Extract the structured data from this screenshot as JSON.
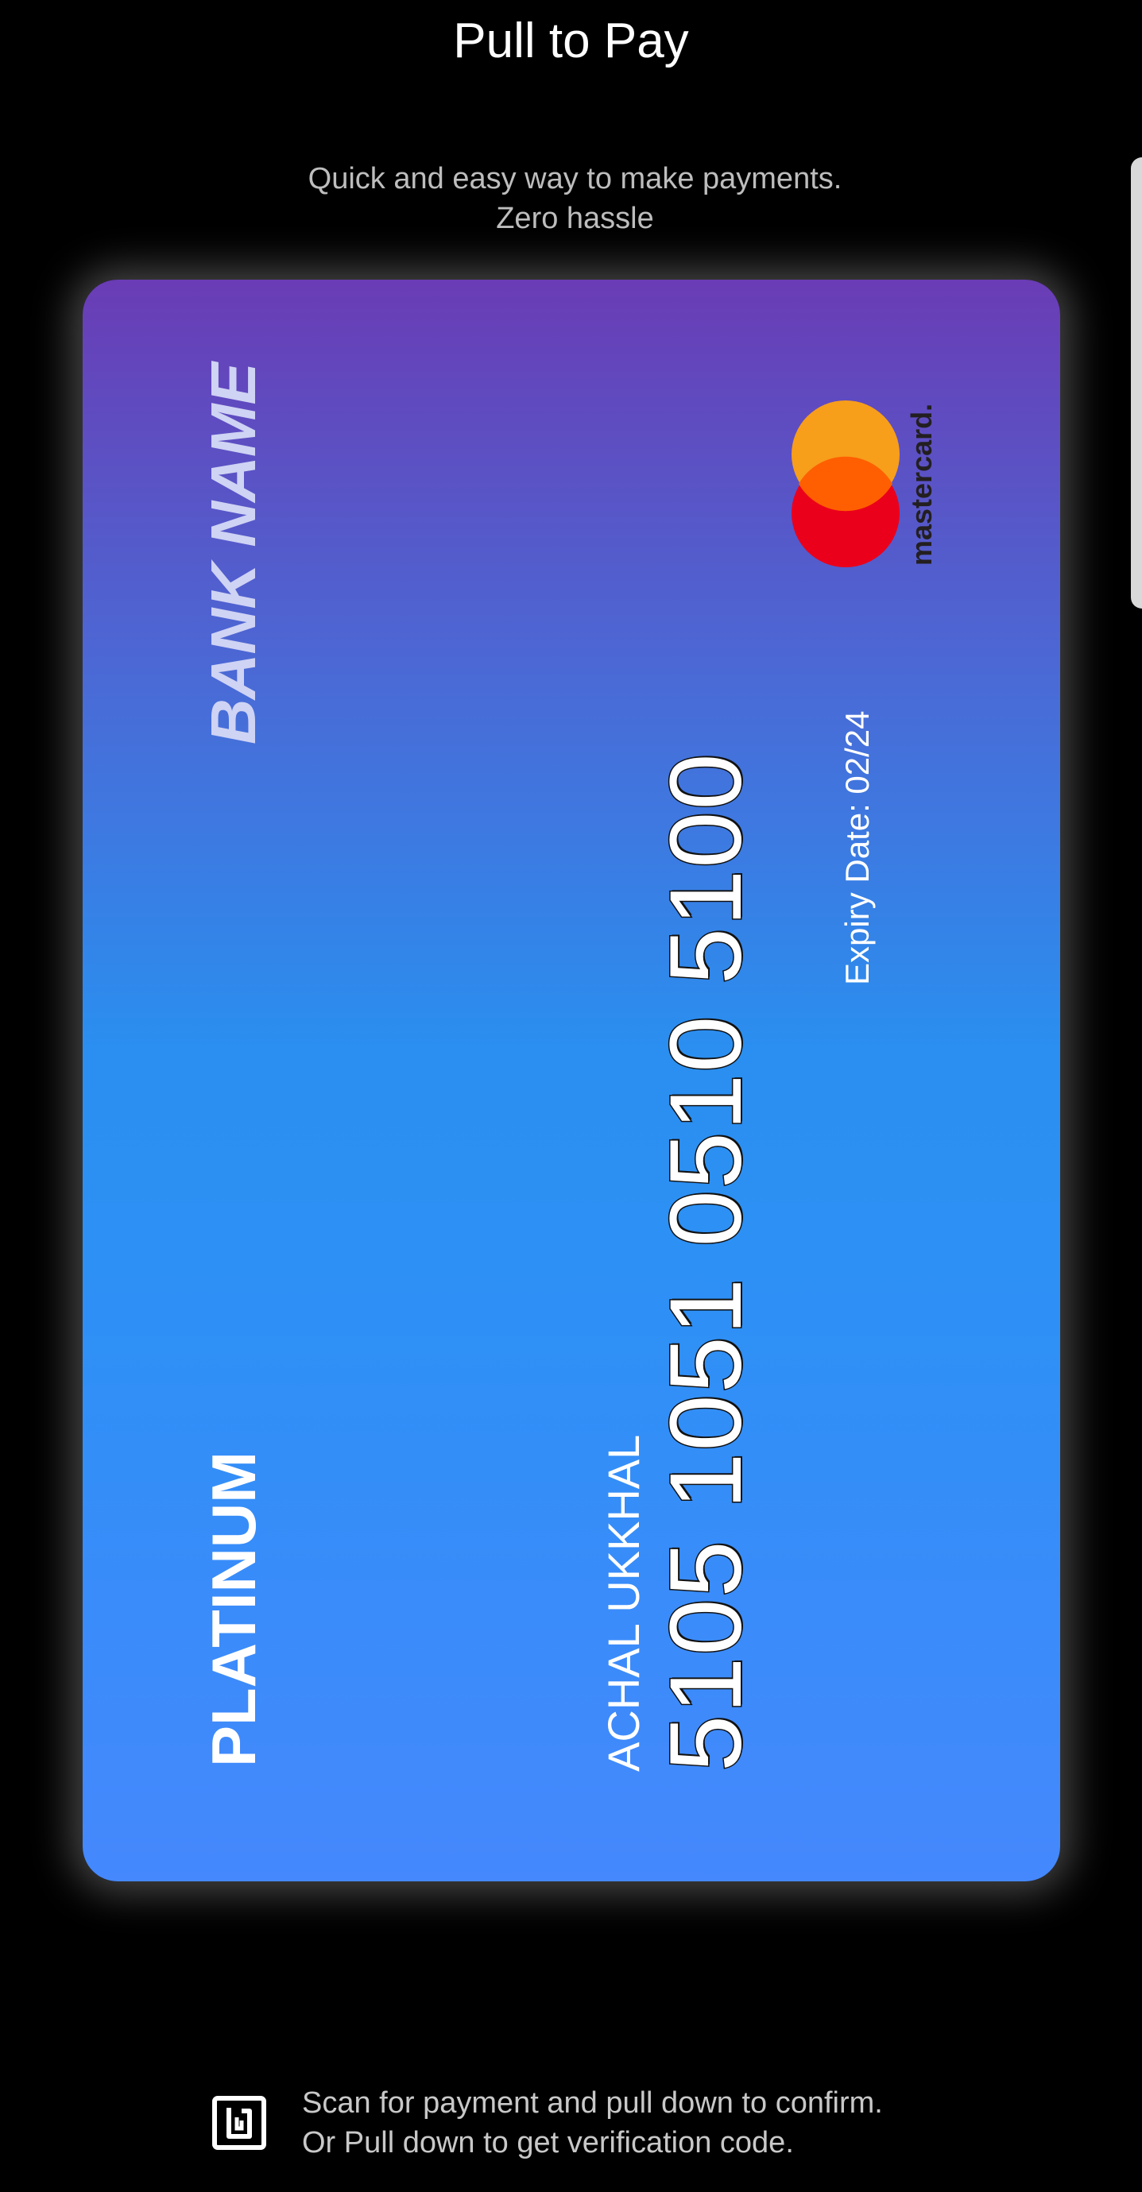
{
  "header": {
    "title": "Pull to Pay",
    "subtitle_line1": "Quick and easy way to make payments.",
    "subtitle_line2": "Zero hassle"
  },
  "card": {
    "bank_name": "BANK NAME",
    "tier": "PLATINUM",
    "holder_name": "ACHAL UKKHAL",
    "number": "5105 1051 0510 5100",
    "expiry": "Expiry Date: 02/24",
    "network": "mastercard",
    "network_logo_text": "mastercard.",
    "colors": {
      "gradient_top": "#6a3cb5",
      "gradient_mid": "#2a8ff0",
      "gradient_bottom": "#4588fd"
    }
  },
  "footer": {
    "icon": "nfc-icon",
    "line1": "Scan for payment and pull down to confirm.",
    "line2": "Or Pull down to get verification code."
  }
}
